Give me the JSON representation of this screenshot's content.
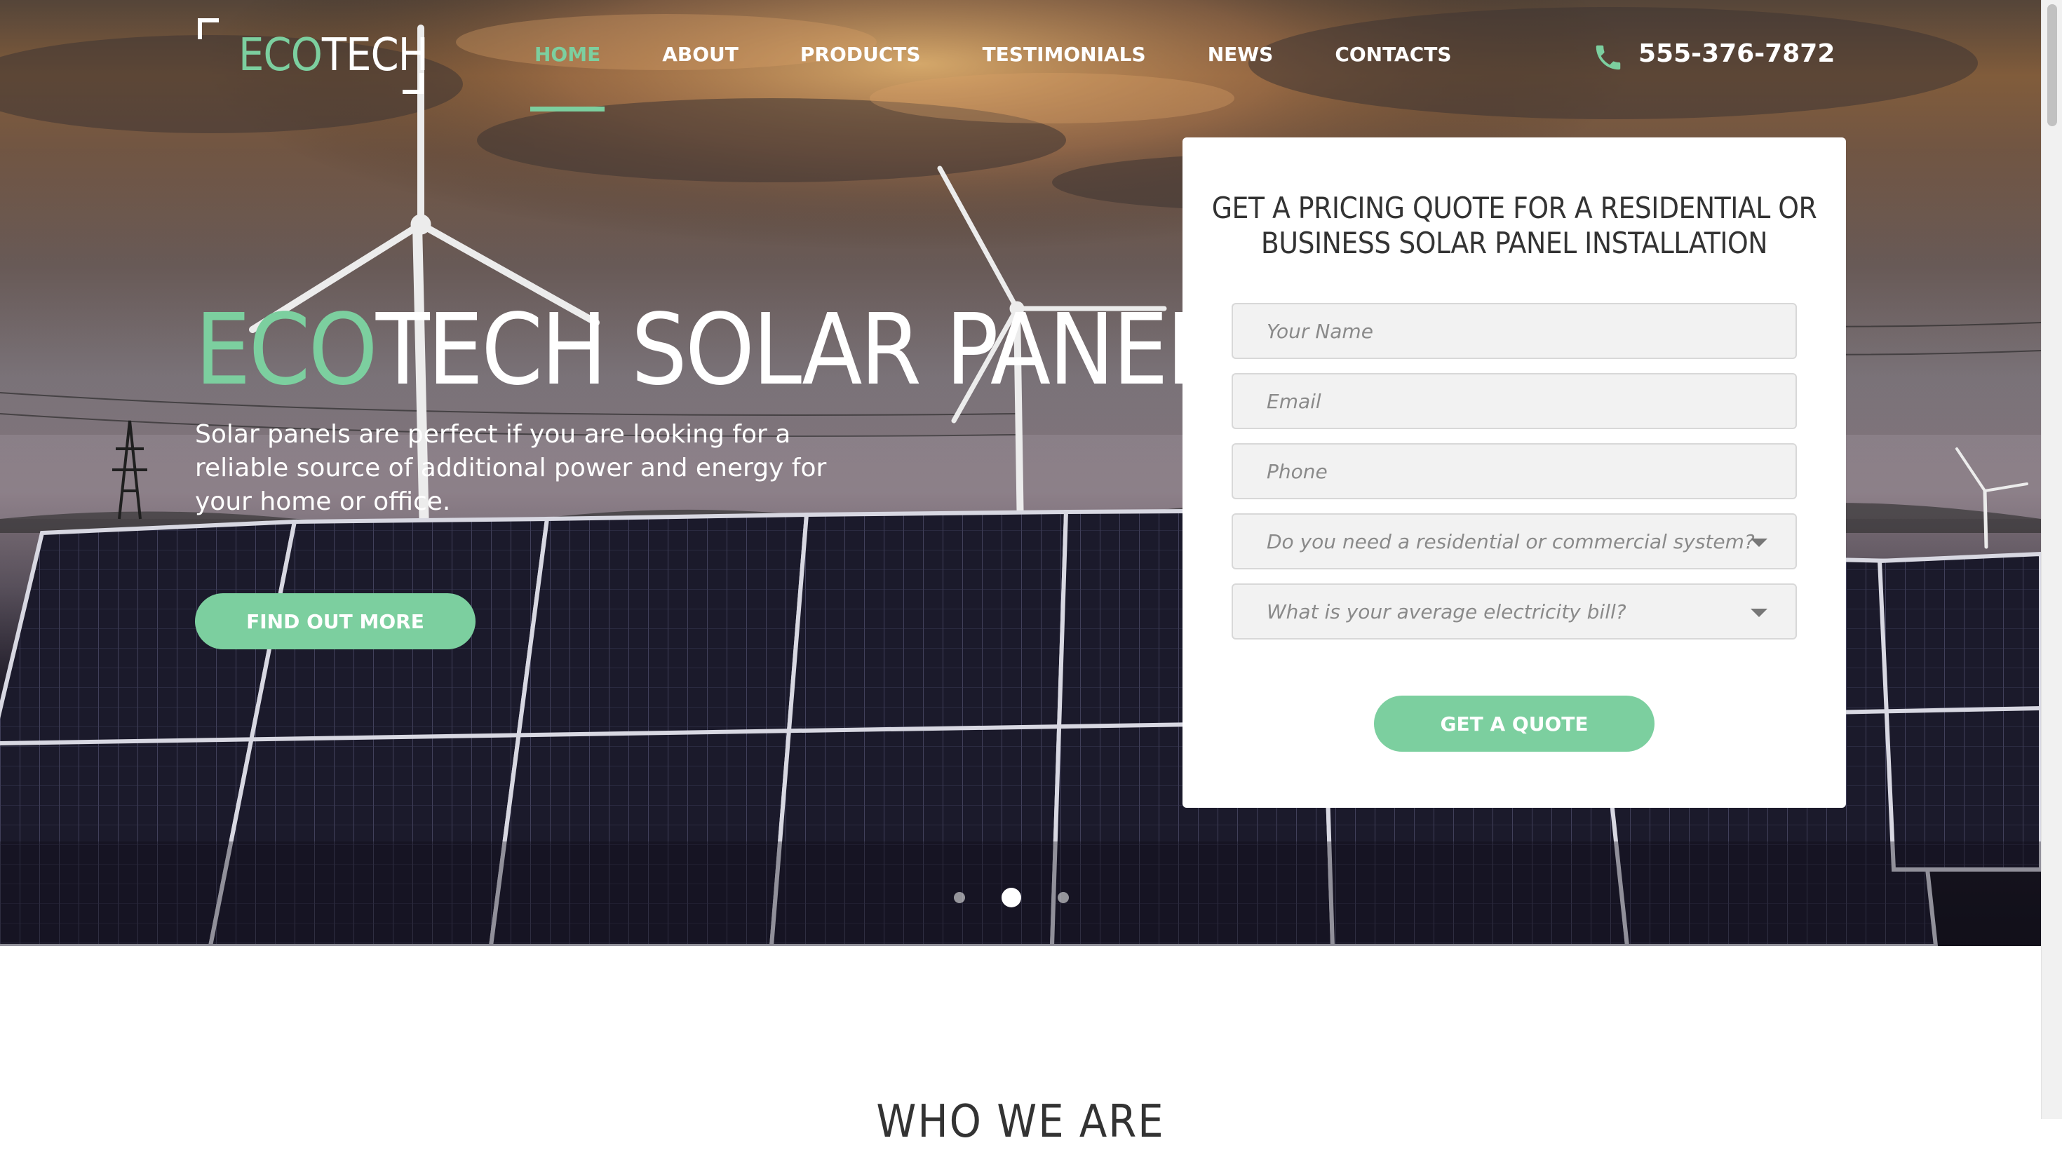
{
  "colors": {
    "accent": "#7ccf9f",
    "text_dark": "#333333",
    "white": "#ffffff"
  },
  "logo": {
    "part1": "ECO",
    "part2": "TECH"
  },
  "nav": {
    "items": [
      {
        "label": "HOME",
        "active": true
      },
      {
        "label": "ABOUT",
        "active": false
      },
      {
        "label": "PRODUCTS",
        "active": false
      },
      {
        "label": "TESTIMONIALS",
        "active": false
      },
      {
        "label": "NEWS",
        "active": false
      },
      {
        "label": "CONTACTS",
        "active": false
      }
    ]
  },
  "phone": {
    "icon": "phone-icon",
    "number": "555-376-7872"
  },
  "hero": {
    "title_accent": "ECO",
    "title_rest": "TECH SOLAR PANELS",
    "description": "Solar panels are perfect if you are looking for a reliable source of additional power and energy for your home or office.",
    "cta_label": "FIND OUT MORE",
    "slider": {
      "count": 3,
      "active_index": 1
    }
  },
  "quote_form": {
    "title": "GET A PRICING QUOTE FOR A RESIDENTIAL OR BUSINESS SOLAR PANEL INSTALLATION",
    "name_placeholder": "Your Name",
    "email_placeholder": "Email",
    "phone_placeholder": "Phone",
    "system_type_placeholder": "Do you need a residential or commercial system?",
    "bill_placeholder": "What is your average electricity bill?",
    "submit_label": "GET A QUOTE"
  },
  "next_section": {
    "heading": "WHO WE ARE"
  }
}
